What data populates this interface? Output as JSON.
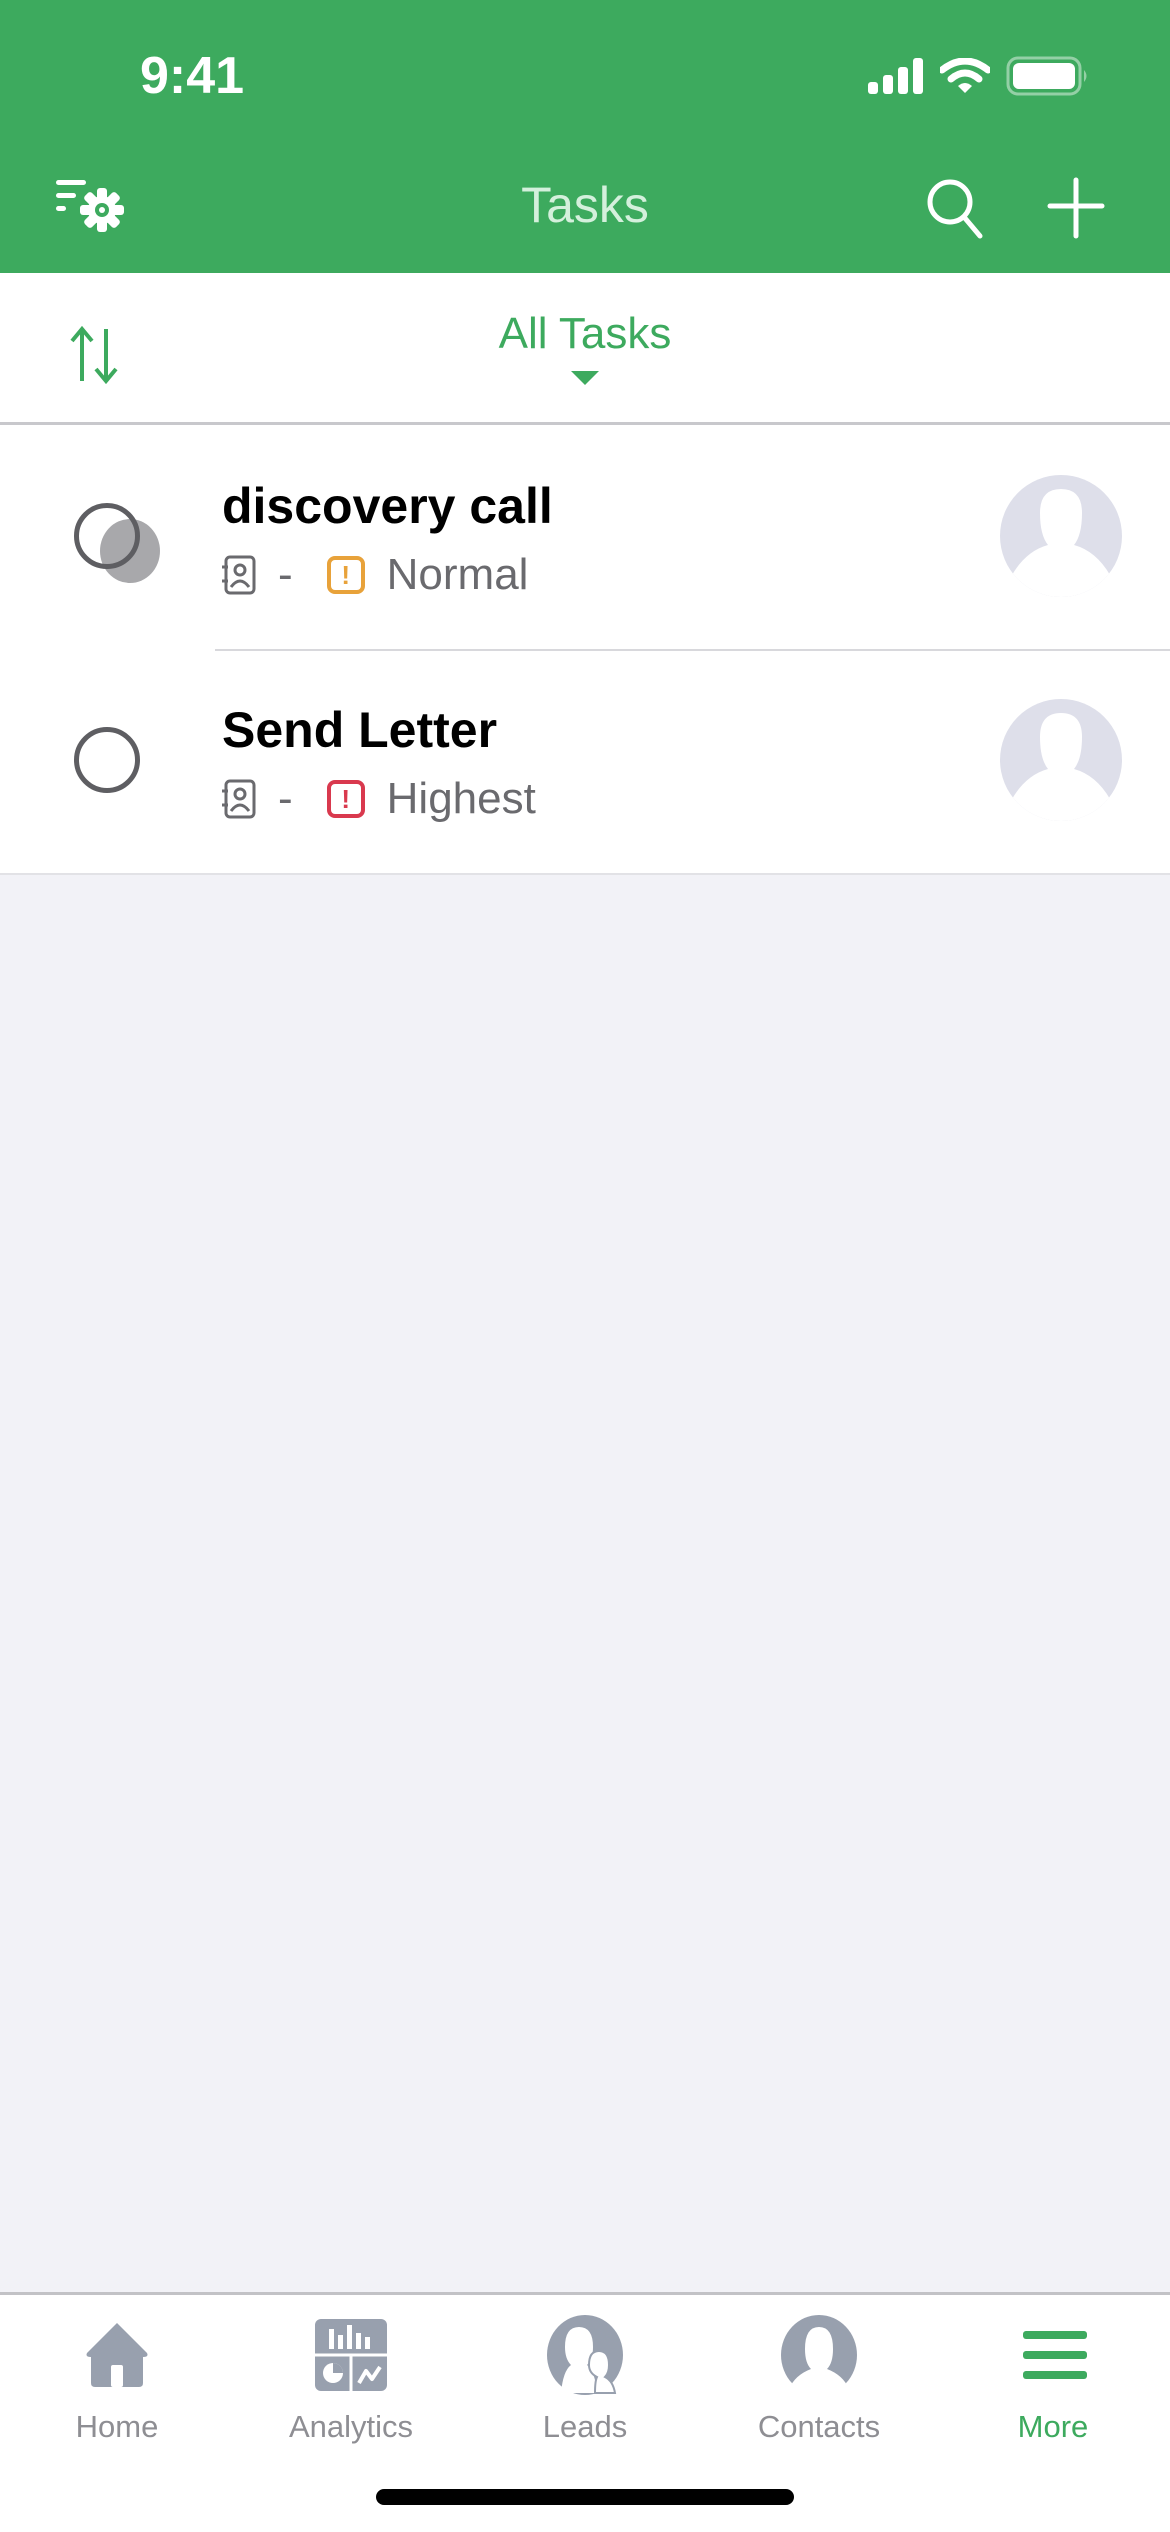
{
  "status_bar": {
    "time": "9:41",
    "icons": [
      "cellular-signal-icon",
      "wifi-icon",
      "battery-icon"
    ]
  },
  "nav_bar": {
    "title": "Tasks",
    "left_icon": "filter-settings-icon",
    "right_icons": [
      "search-icon",
      "plus-icon"
    ]
  },
  "filter_bar": {
    "sort_icon": "sort-arrows-icon",
    "view_label": "All Tasks",
    "view_caret_icon": "caret-down-icon"
  },
  "tasks": [
    {
      "title": "discovery call",
      "related_icon": "contact-book-icon",
      "related_value": "-",
      "priority": "Normal",
      "priority_color": "#E8A23A",
      "priority_icon": "exclamation-icon",
      "completed": false,
      "avatar_icon": "default-avatar-icon"
    },
    {
      "title": "Send Letter",
      "related_icon": "contact-book-icon",
      "related_value": "-",
      "priority": "Highest",
      "priority_color": "#D9394E",
      "priority_icon": "exclamation-icon",
      "completed": false,
      "avatar_icon": "default-avatar-icon"
    }
  ],
  "tab_bar": {
    "items": [
      {
        "label": "Home",
        "icon": "home-icon",
        "active": false
      },
      {
        "label": "Analytics",
        "icon": "analytics-icon",
        "active": false
      },
      {
        "label": "Leads",
        "icon": "leads-icon",
        "active": false
      },
      {
        "label": "Contacts",
        "icon": "contacts-icon",
        "active": false
      },
      {
        "label": "More",
        "icon": "menu-icon",
        "active": true
      }
    ]
  },
  "colors": {
    "brand_green": "#3DAA5E",
    "title_tint": "#D4F0DC",
    "inactive_tab": "#8E8E93",
    "background": "#F2F2F7"
  }
}
